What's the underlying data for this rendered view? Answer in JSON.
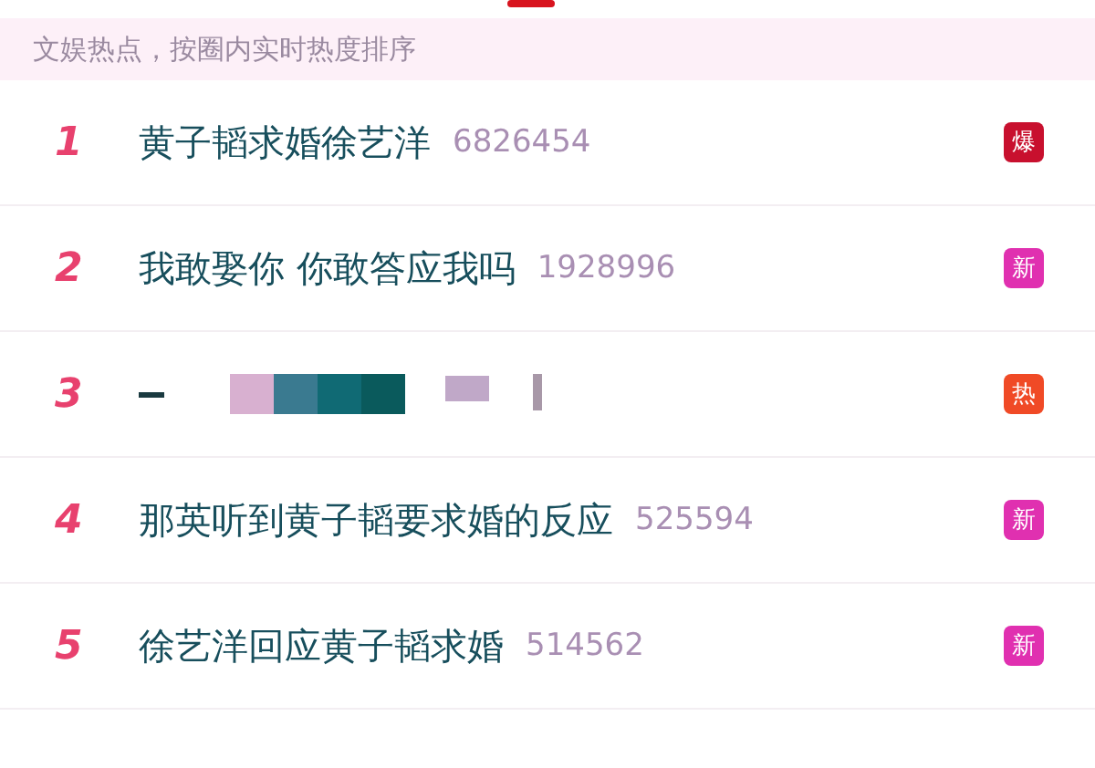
{
  "header": {
    "text": "文娱热点，按圈内实时热度排序"
  },
  "rows": [
    {
      "kind": "normal",
      "rank": "1",
      "title": "黄子韬求婚徐艺洋",
      "count": "6826454",
      "badge": "爆",
      "color": "#c8102e"
    },
    {
      "kind": "normal",
      "rank": "2",
      "title": "我敢娶你 你敢答应我吗",
      "count": "1928996",
      "badge": "新",
      "color": "#e030b0"
    },
    {
      "kind": "redacted",
      "rank": "3",
      "badge": "热",
      "color": "#f04a26"
    },
    {
      "kind": "normal",
      "rank": "4",
      "title": "那英听到黄子韬要求婚的反应",
      "count": "525594",
      "badge": "新",
      "color": "#e030b0"
    },
    {
      "kind": "normal",
      "rank": "5",
      "title": "徐艺洋回应黄子韬求婚",
      "count": "514562",
      "badge": "新",
      "color": "#e030b0"
    }
  ]
}
